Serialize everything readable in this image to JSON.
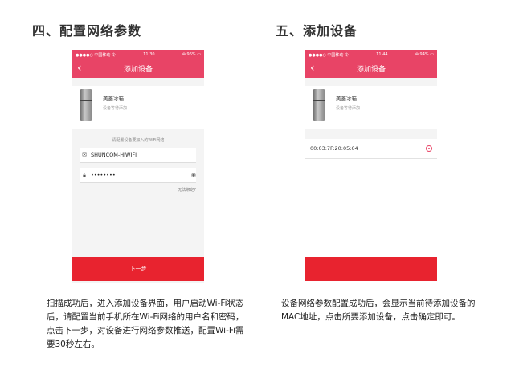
{
  "step4": {
    "title": "四、配置网络参数",
    "status_left": "●●●●○ 中国移动 令",
    "status_time": "11:30",
    "status_right": "⊕ 96% ▭",
    "nav_title": "添加设备",
    "device_name": "美菱冰箱",
    "device_status": "设备等待添加",
    "hint": "请配置设备要加入的WiFi网络",
    "ssid_value": "SHUNCOM-HIWIFI",
    "password_value": "••••••••",
    "forgot_label": "无法绑定?",
    "next_label": "下一步",
    "description": "扫描成功后，进入添加设备界面，用户启动Wi-Fi状态后，请配置当前手机所在Wi-Fi网络的用户名和密码，点击下一步，对设备进行网络参数推送，配置Wi-Fi需要30秒左右。"
  },
  "step5": {
    "title": "五、添加设备",
    "status_left": "●●●●○ 中国移动 令",
    "status_time": "11:44",
    "status_right": "⊕ 94% ▭",
    "nav_title": "添加设备",
    "device_name": "美菱冰箱",
    "device_status": "设备等待添加",
    "mac_address": "00:03:7F:20:05:64",
    "description": "设备网络参数配置成功后，会显示当前待添加设备的MAC地址，点击所要添加设备，点击确定即可。"
  },
  "colors": {
    "accent": "#e84466",
    "button": "#e8232f"
  },
  "icons": [
    "back-arrow-icon",
    "mail-icon",
    "lock-icon",
    "eye-icon",
    "radio-icon"
  ]
}
